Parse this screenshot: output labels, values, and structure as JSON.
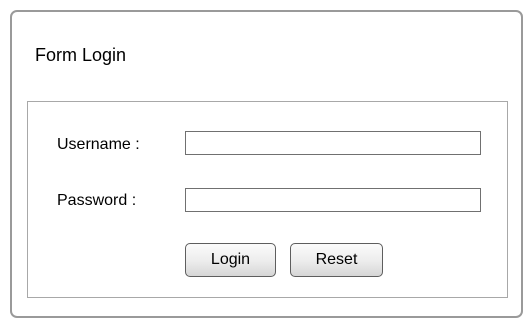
{
  "window": {
    "title": "Form Login"
  },
  "form": {
    "username": {
      "label": "Username :",
      "value": ""
    },
    "password": {
      "label": "Password :",
      "value": ""
    },
    "buttons": {
      "login_label": "Login",
      "reset_label": "Reset"
    }
  }
}
